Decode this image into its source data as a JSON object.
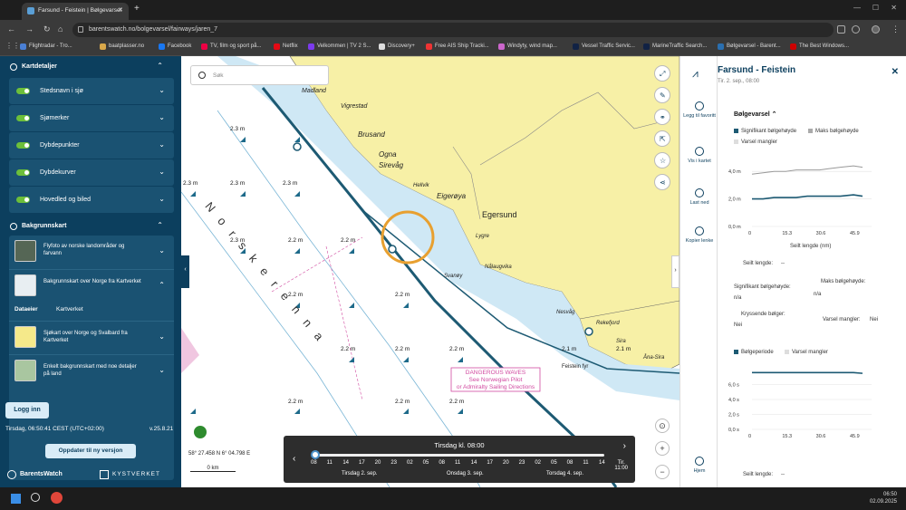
{
  "browser": {
    "tab_title": "Farsund - Feistein | Bølgevarsel",
    "url": "barentswatch.no/bolgevarsel/fairways/jaren_7",
    "bookmarks": [
      "Flightradar - Tro...",
      "baatplasser.no",
      "Facebook",
      "TV, film og sport på...",
      "Netflix",
      "Velkommen | TV 2 S...",
      "Discovery+",
      "Free AIS Ship Tracki...",
      "Windyty, wind map...",
      "Vessel Traffic Servic...",
      "MarineTraffic Search...",
      "Bølgevarsel - Barent...",
      "The Best Windows..."
    ]
  },
  "left": {
    "map_details_title": "Kartdetaljer",
    "layers": [
      "Stedsnavn i sjø",
      "Sjømerker",
      "Dybdepunkter",
      "Dybdekurver",
      "Hovedled og biled"
    ],
    "bg_title": "Bakgrunnskart",
    "bg_items": [
      "Flyfoto av norske landområder og farvann",
      "Bakgrunnskart over Norge fra Kartverket"
    ],
    "data_owner_label": "Dataeier",
    "data_owner_link": "Kartverket",
    "bg_items2": [
      "Sjøkart over Norge og Svalbard fra Kartverket",
      "Enkelt bakgrunnskart med noe detaljer på land"
    ],
    "login": "Logg inn",
    "time": "Tirsdag, 06:50:41 CEST (UTC+02:00)",
    "version": "v.25.8.21",
    "update_btn": "Oppdater til ny versjon",
    "logo_bw": "BarentsWatch",
    "logo_kv": "KYSTVERKET"
  },
  "map": {
    "search_placeholder": "Søk",
    "coords": "58° 27.458 N  6° 04.798 E",
    "scale": "0 km",
    "places": [
      "Madland",
      "Vigrestad",
      "Brusand",
      "Ogna",
      "Sirevåg",
      "Hellvik",
      "Eigerøya",
      "Egersund",
      "Lygre",
      "Nesvåg",
      "Rekefjord",
      "Sira",
      "Åna-Sira",
      "Svanøy",
      "Nålaugvika",
      "Norskerenna"
    ],
    "depth_label": "2.3 m",
    "depth_values": [
      "2.3 m",
      "2.3 m",
      "2.3 m",
      "2.3 m",
      "2.3 m",
      "2.2 m",
      "2.2 m",
      "2.2 m",
      "2.2 m",
      "2.2 m",
      "2.1 m",
      "2.1 m",
      "2.2 m",
      "2.2 m",
      "2.2 m",
      "2.2 m",
      "2.2 m"
    ],
    "warning": [
      "DANGEROUS WAVES",
      "See Norwegian Pilot",
      "or Admiralty Sailing Directions"
    ],
    "lighthouse": "Feistein fyr"
  },
  "slider": {
    "title": "Tirsdag kl. 08:00",
    "hours": [
      "08",
      "11",
      "14",
      "17",
      "20",
      "23",
      "02",
      "05",
      "08",
      "11",
      "14",
      "17",
      "20",
      "23",
      "02",
      "05",
      "08",
      "11",
      "14"
    ],
    "days": [
      "Tirsdag 2. sep.",
      "Onsdag 3. sep.",
      "Torsdag 4. sep."
    ],
    "now_day": "Tir.",
    "now_time": "11:00",
    "position": 0.0
  },
  "rail": [
    "Legg til favoritt",
    "Vis i kartet",
    "Last ned",
    "Kopier lenke",
    "Hjem"
  ],
  "right": {
    "title": "Farsund - Feistein",
    "subtitle": "Tir. 2. sep., 08:00",
    "section": "Bølgevarsel",
    "legend1": [
      "Signifikant bølgehøyde",
      "Maks bølgehøyde",
      "Varsel mangler"
    ],
    "xaxis": [
      "0",
      "15.3",
      "30.6",
      "45.9"
    ],
    "xlabel": "Seilt lengde (nm)",
    "sailed_label": "Seilt lengde:",
    "sailed_value": "--",
    "stat1_label": "Signifikant bølgehøyde:",
    "stat1_value": "n/a",
    "stat2_label": "Maks bølgehøyde:",
    "stat2_value": "n/a",
    "stat3_label": "Kryssende bølger:",
    "stat3_value": "Nei",
    "stat4_label": "Varsel mangler:",
    "stat4_value": "Nei",
    "legend2": [
      "Bølgeperiode",
      "Varsel mangler"
    ],
    "sailed_label2": "Seilt lengde:",
    "sailed_value2": "--"
  },
  "chart_data": [
    {
      "type": "line",
      "title": "",
      "xlabel": "Seilt lengde (nm)",
      "ylabel": "",
      "x": [
        0,
        5,
        10,
        15.3,
        20,
        25,
        30.6,
        35,
        40,
        45.9,
        50
      ],
      "series": [
        {
          "name": "Signifikant bølgehøyde",
          "values": [
            2.0,
            2.0,
            2.1,
            2.1,
            2.1,
            2.2,
            2.2,
            2.2,
            2.2,
            2.3,
            2.2
          ]
        },
        {
          "name": "Maks bølgehøyde",
          "values": [
            3.8,
            3.9,
            4.0,
            4.0,
            4.1,
            4.1,
            4.1,
            4.2,
            4.3,
            4.4,
            4.3
          ]
        }
      ],
      "yticks": [
        "0,0 m",
        "2,0 m",
        "4,0 m"
      ],
      "ylim": [
        0,
        5
      ]
    },
    {
      "type": "line",
      "title": "",
      "xlabel": "",
      "x": [
        0,
        5,
        10,
        15.3,
        20,
        25,
        30.6,
        35,
        40,
        45.9,
        50
      ],
      "series": [
        {
          "name": "Bølgeperiode",
          "values": [
            7.6,
            7.6,
            7.6,
            7.6,
            7.6,
            7.6,
            7.6,
            7.6,
            7.6,
            7.6,
            7.5
          ]
        }
      ],
      "yticks": [
        "0,0 s",
        "2,0 s",
        "4,0 s",
        "6,0 s"
      ],
      "ylim": [
        0,
        8
      ]
    }
  ],
  "taskbar": {
    "time": "06:50",
    "date": "02.09.2025"
  }
}
